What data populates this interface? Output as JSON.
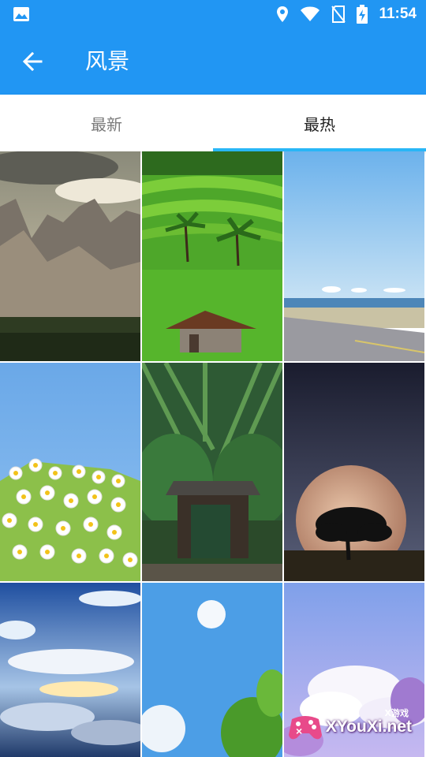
{
  "status_bar": {
    "time": "11:54",
    "icons": [
      "image-icon",
      "location-icon",
      "wifi-icon",
      "no-sim-icon",
      "battery-charging-icon"
    ]
  },
  "app_bar": {
    "title": "风景",
    "back_icon": "arrow-left-icon"
  },
  "tabs": [
    {
      "label": "最新",
      "selected": false
    },
    {
      "label": "最热",
      "selected": true
    }
  ],
  "wallpapers": [
    {
      "subject": "mountain-peaks"
    },
    {
      "subject": "rice-terraces"
    },
    {
      "subject": "coastal-road"
    },
    {
      "subject": "daisy-flowers"
    },
    {
      "subject": "bamboo-gate"
    },
    {
      "subject": "moon-tree"
    },
    {
      "subject": "sky-clouds-sunset"
    },
    {
      "subject": "blue-sky-tree"
    },
    {
      "subject": "purple-sky-clouds"
    }
  ],
  "watermark": {
    "sub": "X游戏",
    "text": "XYouXi.net"
  },
  "colors": {
    "primary": "#2196f3",
    "tab_indicator": "#29b6f6",
    "tab_active_text": "#212121",
    "tab_inactive_text": "#7a7a7a"
  }
}
